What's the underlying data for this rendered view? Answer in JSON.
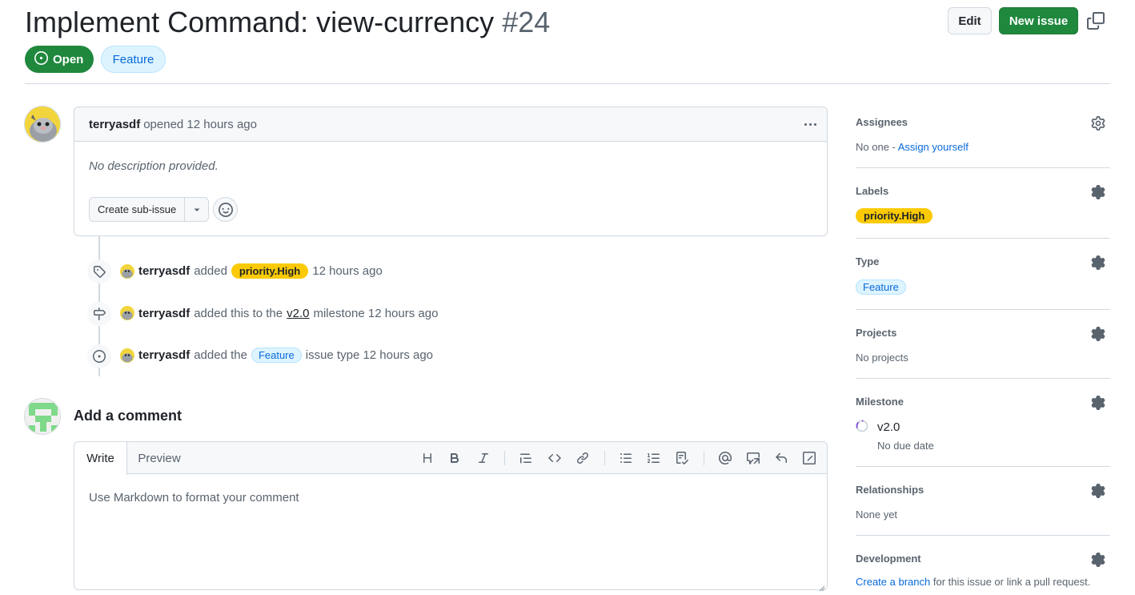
{
  "header": {
    "title": "Implement Command: view-currency",
    "number": "#24",
    "edit_label": "Edit",
    "new_issue_label": "New issue",
    "state_label": "Open",
    "type_label": "Feature"
  },
  "comment": {
    "author": "terryasdf",
    "meta": "opened 12 hours ago",
    "body": "No description provided.",
    "subissue_label": "Create sub-issue"
  },
  "timeline": [
    {
      "author": "terryasdf",
      "pre": "added",
      "label": "priority.High",
      "post": "12 hours ago"
    },
    {
      "author": "terryasdf",
      "pre": "added this to the",
      "link": "v2.0",
      "post": "milestone 12 hours ago"
    },
    {
      "author": "terryasdf",
      "pre": "added the",
      "label": "Feature",
      "post": "issue type 12 hours ago"
    }
  ],
  "composer": {
    "title": "Add a comment",
    "tab_write": "Write",
    "tab_preview": "Preview",
    "placeholder": "Use Markdown to format your comment"
  },
  "sidebar": {
    "assignees": {
      "title": "Assignees",
      "value_pre": "No one - ",
      "link": "Assign yourself"
    },
    "labels": {
      "title": "Labels",
      "label": "priority.High"
    },
    "type": {
      "title": "Type",
      "label": "Feature"
    },
    "projects": {
      "title": "Projects",
      "value": "No projects"
    },
    "milestone": {
      "title": "Milestone",
      "name": "v2.0",
      "due": "No due date"
    },
    "relationships": {
      "title": "Relationships",
      "value": "None yet"
    },
    "development": {
      "title": "Development",
      "link": "Create a branch",
      "value_post": " for this issue or link a pull request."
    }
  },
  "colors": {
    "open_green": "#1f883d",
    "label_priority": "#fbca04",
    "feature_bg": "#ddf4ff",
    "feature_text": "#0969da",
    "link": "#0969da"
  },
  "icons": [
    "copy-icon",
    "issue-open-icon",
    "kebab-icon",
    "triangle-down-icon",
    "smiley-icon",
    "tag-icon",
    "milestone-icon",
    "issue-type-icon",
    "heading-icon",
    "bold-icon",
    "italic-icon",
    "quote-icon",
    "code-icon",
    "link-icon",
    "unordered-list-icon",
    "ordered-list-icon",
    "task-list-icon",
    "mention-icon",
    "reference-icon",
    "reply-icon",
    "slash-command-icon",
    "gear-icon",
    "milestone-progress-icon"
  ]
}
